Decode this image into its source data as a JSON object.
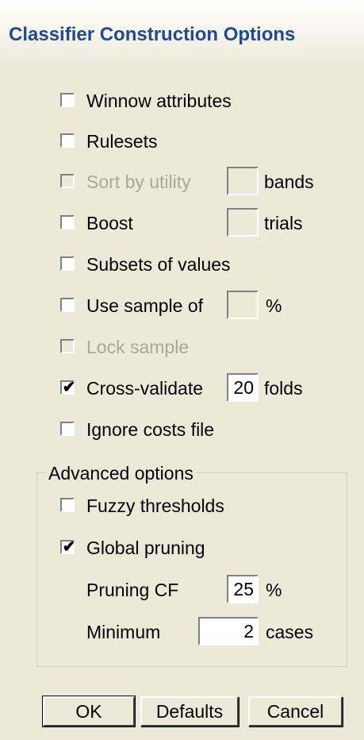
{
  "window": {
    "title": "Classifier Construction Options"
  },
  "options": {
    "winnow": {
      "label": "Winnow attributes",
      "checked": false,
      "enabled": true
    },
    "rulesets": {
      "label": "Rulesets",
      "checked": false,
      "enabled": true
    },
    "sort_by_utility": {
      "label": "Sort by utility",
      "checked": false,
      "enabled": false,
      "value": "",
      "unit": "bands"
    },
    "boost": {
      "label": "Boost",
      "checked": false,
      "enabled": true,
      "value": "",
      "unit": "trials"
    },
    "subsets": {
      "label": "Subsets of values",
      "checked": false,
      "enabled": true
    },
    "sample": {
      "label": "Use sample of",
      "checked": false,
      "enabled": true,
      "value": "",
      "unit": "%"
    },
    "lock_sample": {
      "label": "Lock sample",
      "checked": false,
      "enabled": false
    },
    "cross_validate": {
      "label": "Cross-validate",
      "checked": true,
      "enabled": true,
      "value": "20",
      "unit": "folds"
    },
    "ignore_costs": {
      "label": "Ignore costs file",
      "checked": false,
      "enabled": true
    }
  },
  "advanced": {
    "legend": "Advanced options",
    "fuzzy": {
      "label": "Fuzzy thresholds",
      "checked": false
    },
    "global_pruning": {
      "label": "Global pruning",
      "checked": true
    },
    "pruning_cf": {
      "label": "Pruning CF",
      "value": "25",
      "unit": "%"
    },
    "minimum": {
      "label": "Minimum",
      "value": "2",
      "unit": "cases"
    }
  },
  "buttons": {
    "ok": "OK",
    "defaults": "Defaults",
    "cancel": "Cancel"
  },
  "colors": {
    "background": "#ece9d8",
    "title": "#1f4a93",
    "disabled_text": "#aca899"
  }
}
